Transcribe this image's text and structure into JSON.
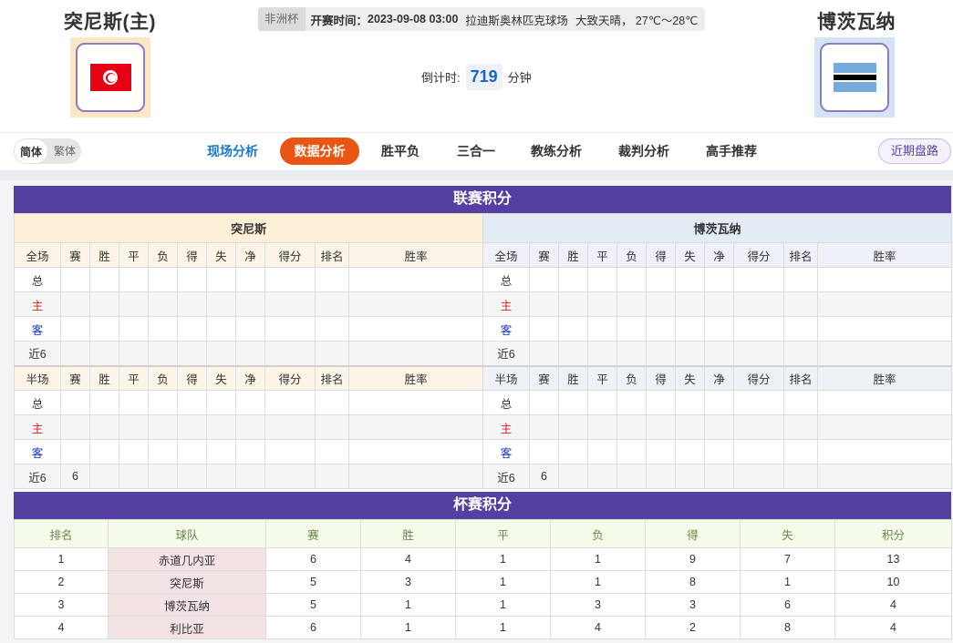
{
  "match": {
    "home_team": "突尼斯(主)",
    "away_team": "博茨瓦纳",
    "league": "非洲杯",
    "kickoff_label": "开赛时间：",
    "kickoff_time": "2023-09-08 03:00",
    "venue": "拉迪斯奥林匹克球场",
    "weather": "大致天晴，  27℃～28℃",
    "countdown_label": "倒计时:",
    "countdown_value": "719",
    "countdown_unit": "分钟"
  },
  "lang": {
    "simplified": "简体",
    "traditional": "繁体"
  },
  "nav": {
    "tabs": [
      "现场分析",
      "数据分析",
      "胜平负",
      "三合一",
      "教练分析",
      "裁判分析",
      "高手推荐"
    ],
    "active": "数据分析",
    "recent_button": "近期盘路"
  },
  "league_table": {
    "title": "联赛积分",
    "home_team": "突尼斯",
    "away_team": "博茨瓦纳",
    "full_header": [
      "全场",
      "赛",
      "胜",
      "平",
      "负",
      "得",
      "失",
      "净",
      "得分",
      "排名",
      "胜率"
    ],
    "half_header": [
      "半场",
      "赛",
      "胜",
      "平",
      "负",
      "得",
      "失",
      "净",
      "得分",
      "排名",
      "胜率"
    ],
    "row_labels": [
      "总",
      "主",
      "客",
      "近6"
    ],
    "home_full_recent6_games": "",
    "home_half_recent6_games": "6",
    "away_full_recent6_games": "",
    "away_half_recent6_games": "6"
  },
  "cup_table": {
    "title": "杯赛积分",
    "headers": [
      "排名",
      "球队",
      "赛",
      "胜",
      "平",
      "负",
      "得",
      "失",
      "积分"
    ],
    "rows": [
      [
        "1",
        "赤道几内亚",
        "6",
        "4",
        "1",
        "1",
        "9",
        "7",
        "13"
      ],
      [
        "2",
        "突尼斯",
        "5",
        "3",
        "1",
        "1",
        "8",
        "1",
        "10"
      ],
      [
        "3",
        "博茨瓦纳",
        "5",
        "1",
        "1",
        "3",
        "3",
        "6",
        "4"
      ],
      [
        "4",
        "利比亚",
        "6",
        "1",
        "1",
        "4",
        "2",
        "8",
        "4"
      ]
    ]
  }
}
